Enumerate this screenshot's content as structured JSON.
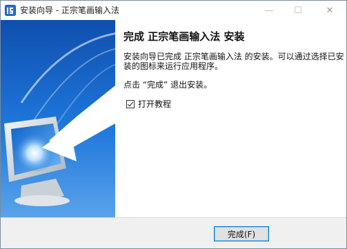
{
  "window": {
    "title": "安装向导 - 正宗笔画输入法",
    "app_icon": "installer-app-icon",
    "controls": {
      "minimize": "—",
      "maximize": "☐",
      "close": "✕"
    }
  },
  "content": {
    "heading": "完成 正宗笔画输入法 安装",
    "paragraph1": "安装向导已完成 正宗笔画输入法 的安装。可以通过选择已安装的图标来运行应用程序。",
    "paragraph2": "点击 “完成” 退出安装。",
    "checkbox": {
      "label": "打开教程",
      "checked": true
    }
  },
  "footer": {
    "finish_label": "完成(F)"
  },
  "colors": {
    "banner_blue": "#1f6fd1",
    "button_border": "#0078d7"
  }
}
